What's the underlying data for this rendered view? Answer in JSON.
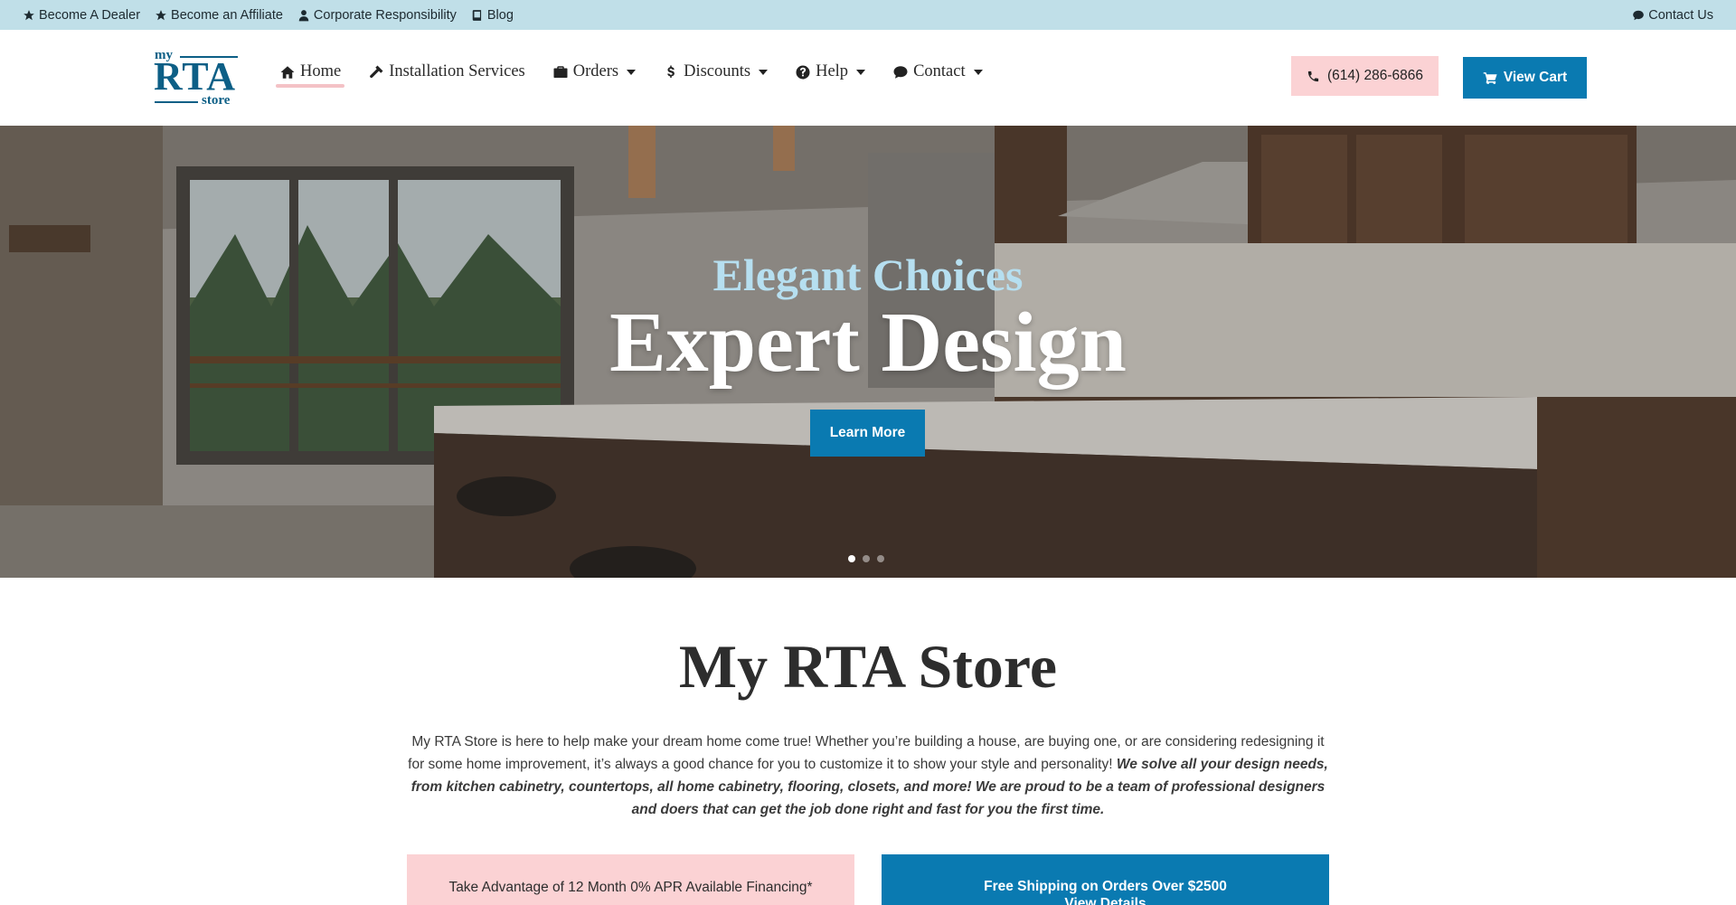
{
  "topbar": {
    "links": [
      {
        "label": "Become A Dealer",
        "icon": "star-icon"
      },
      {
        "label": "Become an Affiliate",
        "icon": "star-icon"
      },
      {
        "label": "Corporate Responsibility",
        "icon": "user-icon"
      },
      {
        "label": "Blog",
        "icon": "book-icon"
      }
    ],
    "contact": {
      "label": "Contact Us",
      "icon": "chat-icon"
    },
    "background": "#c0dfe8"
  },
  "logo": {
    "my": "my",
    "rta": "RTA",
    "store": "store",
    "color": "#0d5f86"
  },
  "nav": {
    "items": [
      {
        "label": "Home",
        "icon": "home-icon",
        "active": true
      },
      {
        "label": "Installation Services",
        "icon": "hammer-icon"
      },
      {
        "label": "Orders",
        "icon": "briefcase-icon",
        "dropdown": true
      },
      {
        "label": "Discounts",
        "icon": "dollar-icon",
        "dropdown": true
      },
      {
        "label": "Help",
        "icon": "question-circle-icon",
        "dropdown": true
      },
      {
        "label": "Contact",
        "icon": "chat-icon",
        "dropdown": true
      }
    ]
  },
  "header": {
    "phone": "(614) 286-6866",
    "cart": "View Cart"
  },
  "hero": {
    "subtitle": "Elegant Choices",
    "title": "Expert Design",
    "button": "Learn More",
    "slides": 3,
    "active_slide": 1
  },
  "main": {
    "title": "My RTA Store",
    "intro_plain": "My RTA Store is here to help make your dream home come true! Whether you’re building a house, are buying one, or are considering redesigning it for some home improvement, it’s always a good chance for you to customize it to show your style and personality!",
    "intro_emphasis": "We solve all your design needs, from kitchen cabinetry, countertops, all home cabinetry, flooring, closets, and more! We are proud to be a team of professional designers and doers that can get the job done right and fast for you the first time.",
    "promo_left": "Take Advantage of 12 Month 0% APR Available Financing*",
    "promo_right_line1": "Free Shipping on Orders Over $2500",
    "promo_right_line2": "View Details"
  },
  "colors": {
    "accent": "#0a7ab1",
    "pink": "#fbd2d4",
    "hero_subtitle": "#b6dff0"
  }
}
